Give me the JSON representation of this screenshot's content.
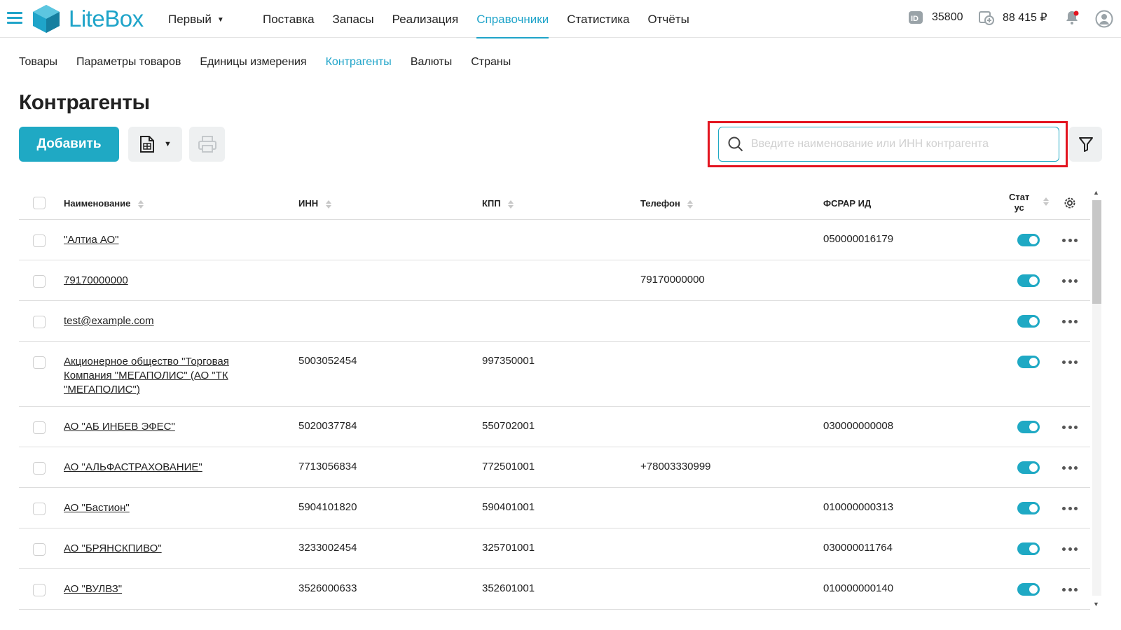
{
  "app": {
    "name": "LiteBox",
    "org": "Первый",
    "brand_color": "#1fa4c9"
  },
  "mainnav": [
    {
      "label": "Поставка"
    },
    {
      "label": "Запасы"
    },
    {
      "label": "Реализация"
    },
    {
      "label": "Справочники",
      "active": true
    },
    {
      "label": "Статистика"
    },
    {
      "label": "Отчёты"
    }
  ],
  "topright": {
    "id_value": "35800",
    "balance": "88 415 ₽"
  },
  "subnav": [
    {
      "label": "Товары"
    },
    {
      "label": "Параметры товаров"
    },
    {
      "label": "Единицы измерения"
    },
    {
      "label": "Контрагенты",
      "active": true
    },
    {
      "label": "Валюты"
    },
    {
      "label": "Страны"
    }
  ],
  "page": {
    "title": "Контрагенты"
  },
  "toolbar": {
    "add_label": "Добавить"
  },
  "search": {
    "placeholder": "Введите наименование или ИНН контрагента",
    "value": ""
  },
  "table": {
    "headers": {
      "name": "Наименование",
      "inn": "ИНН",
      "kpp": "КПП",
      "phone": "Телефон",
      "fsrar": "ФСРАР ИД",
      "status_line1": "Стат",
      "status_line2": "ус"
    },
    "rows": [
      {
        "name": "\"Алтиа АО\"",
        "inn": "",
        "kpp": "",
        "phone": "",
        "fsrar": "050000016179",
        "status": true
      },
      {
        "name": "79170000000",
        "inn": "",
        "kpp": "",
        "phone": "79170000000",
        "fsrar": "",
        "status": true
      },
      {
        "name": "test@example.com",
        "inn": "",
        "kpp": "",
        "phone": "",
        "fsrar": "",
        "status": true
      },
      {
        "name": "Акционерное общество \"Торговая Компания \"МЕГАПОЛИС\" (АО \"ТК \"МЕГАПОЛИС\")",
        "inn": "5003052454",
        "kpp": "997350001",
        "phone": "",
        "fsrar": "",
        "status": true
      },
      {
        "name": "АО \"АБ ИНБЕВ ЭФЕС\"",
        "inn": "5020037784",
        "kpp": "550702001",
        "phone": "",
        "fsrar": "030000000008",
        "status": true
      },
      {
        "name": "АО \"АЛЬФАСТРАХОВАНИЕ\"",
        "inn": "7713056834",
        "kpp": "772501001",
        "phone": "+78003330999",
        "fsrar": "",
        "status": true
      },
      {
        "name": "АО \"Бастион\"",
        "inn": "5904101820",
        "kpp": "590401001",
        "phone": "",
        "fsrar": "010000000313",
        "status": true
      },
      {
        "name": "АО \"БРЯНСКПИВО\"",
        "inn": "3233002454",
        "kpp": "325701001",
        "phone": "",
        "fsrar": "030000011764",
        "status": true
      },
      {
        "name": "АО \"ВУЛВЗ\"",
        "inn": "3526000633",
        "kpp": "352601001",
        "phone": "",
        "fsrar": "010000000140",
        "status": true
      }
    ]
  }
}
